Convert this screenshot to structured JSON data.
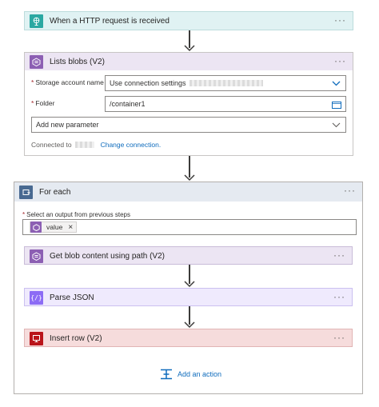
{
  "trigger": {
    "title": "When a HTTP request is received",
    "icon": "http-globe-icon",
    "color": "#2ba8a2"
  },
  "list_blobs": {
    "title": "Lists blobs (V2)",
    "icon": "blob-storage-icon",
    "color": "#8c5fb3",
    "fields": {
      "storage_label": "Storage account name",
      "storage_value": "Use connection settings",
      "folder_label": "Folder",
      "folder_value": "/container1",
      "add_param_placeholder": "Add new parameter"
    },
    "connected_to_label": "Connected to",
    "change_connection_link": "Change connection."
  },
  "for_each": {
    "title": "For each",
    "icon": "loop-icon",
    "color": "#486991",
    "select_label": "Select an output from previous steps",
    "token_label": "value",
    "token_remove": "×",
    "actions": [
      {
        "title": "Get blob content using path (V2)",
        "icon": "blob-storage-icon",
        "color": "#8c5fb3"
      },
      {
        "title": "Parse JSON",
        "icon": "braces-icon",
        "color": "#8c6cf5"
      },
      {
        "title": "Insert row (V2)",
        "icon": "sql-server-icon",
        "color": "#ba141a"
      }
    ],
    "add_action_label": "Add an action"
  },
  "more_label": "···"
}
